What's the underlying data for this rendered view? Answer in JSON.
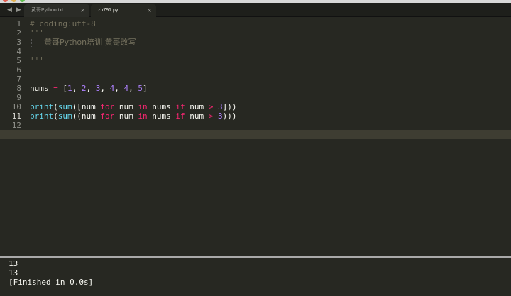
{
  "window": {
    "title": "zh791.py"
  },
  "tabs": [
    {
      "label": "黄哥Python.txt",
      "close": "×",
      "active": false
    },
    {
      "label": "zh791.py",
      "close": "×",
      "active": true
    }
  ],
  "nav": {
    "back": "◀",
    "forward": "▶"
  },
  "editor": {
    "current_line": 11,
    "line_numbers": [
      "1",
      "2",
      "3",
      "4",
      "5",
      "6",
      "7",
      "8",
      "9",
      "10",
      "11",
      "12"
    ],
    "lines": {
      "l1": "# coding:utf-8",
      "l2": "'''",
      "l3": "黄哥Python培训 黄哥改写",
      "l5": "'''",
      "l8": {
        "var": "nums",
        "eq": "=",
        "open": "[",
        "n1": "1",
        "n2": "2",
        "n3": "3",
        "n4": "4",
        "n5": "4",
        "n6": "5",
        "close": "]"
      },
      "l10": {
        "print": "print",
        "sum": "sum",
        "open": "([",
        "var1": "num",
        "for": "for",
        "var2": "num",
        "in": "in",
        "var3": "nums",
        "if": "if",
        "var4": "num",
        "gt": ">",
        "num": "3",
        "close": "]))"
      },
      "l11": {
        "print": "print",
        "sum": "sum",
        "open": "((",
        "var1": "num",
        "for": "for",
        "var2": "num",
        "in": "in",
        "var3": "nums",
        "if": "if",
        "var4": "num",
        "gt": ">",
        "num": "3",
        "close": ")))"
      }
    }
  },
  "output": {
    "lines": [
      "13",
      "13",
      "[Finished in 0.0s]"
    ]
  }
}
